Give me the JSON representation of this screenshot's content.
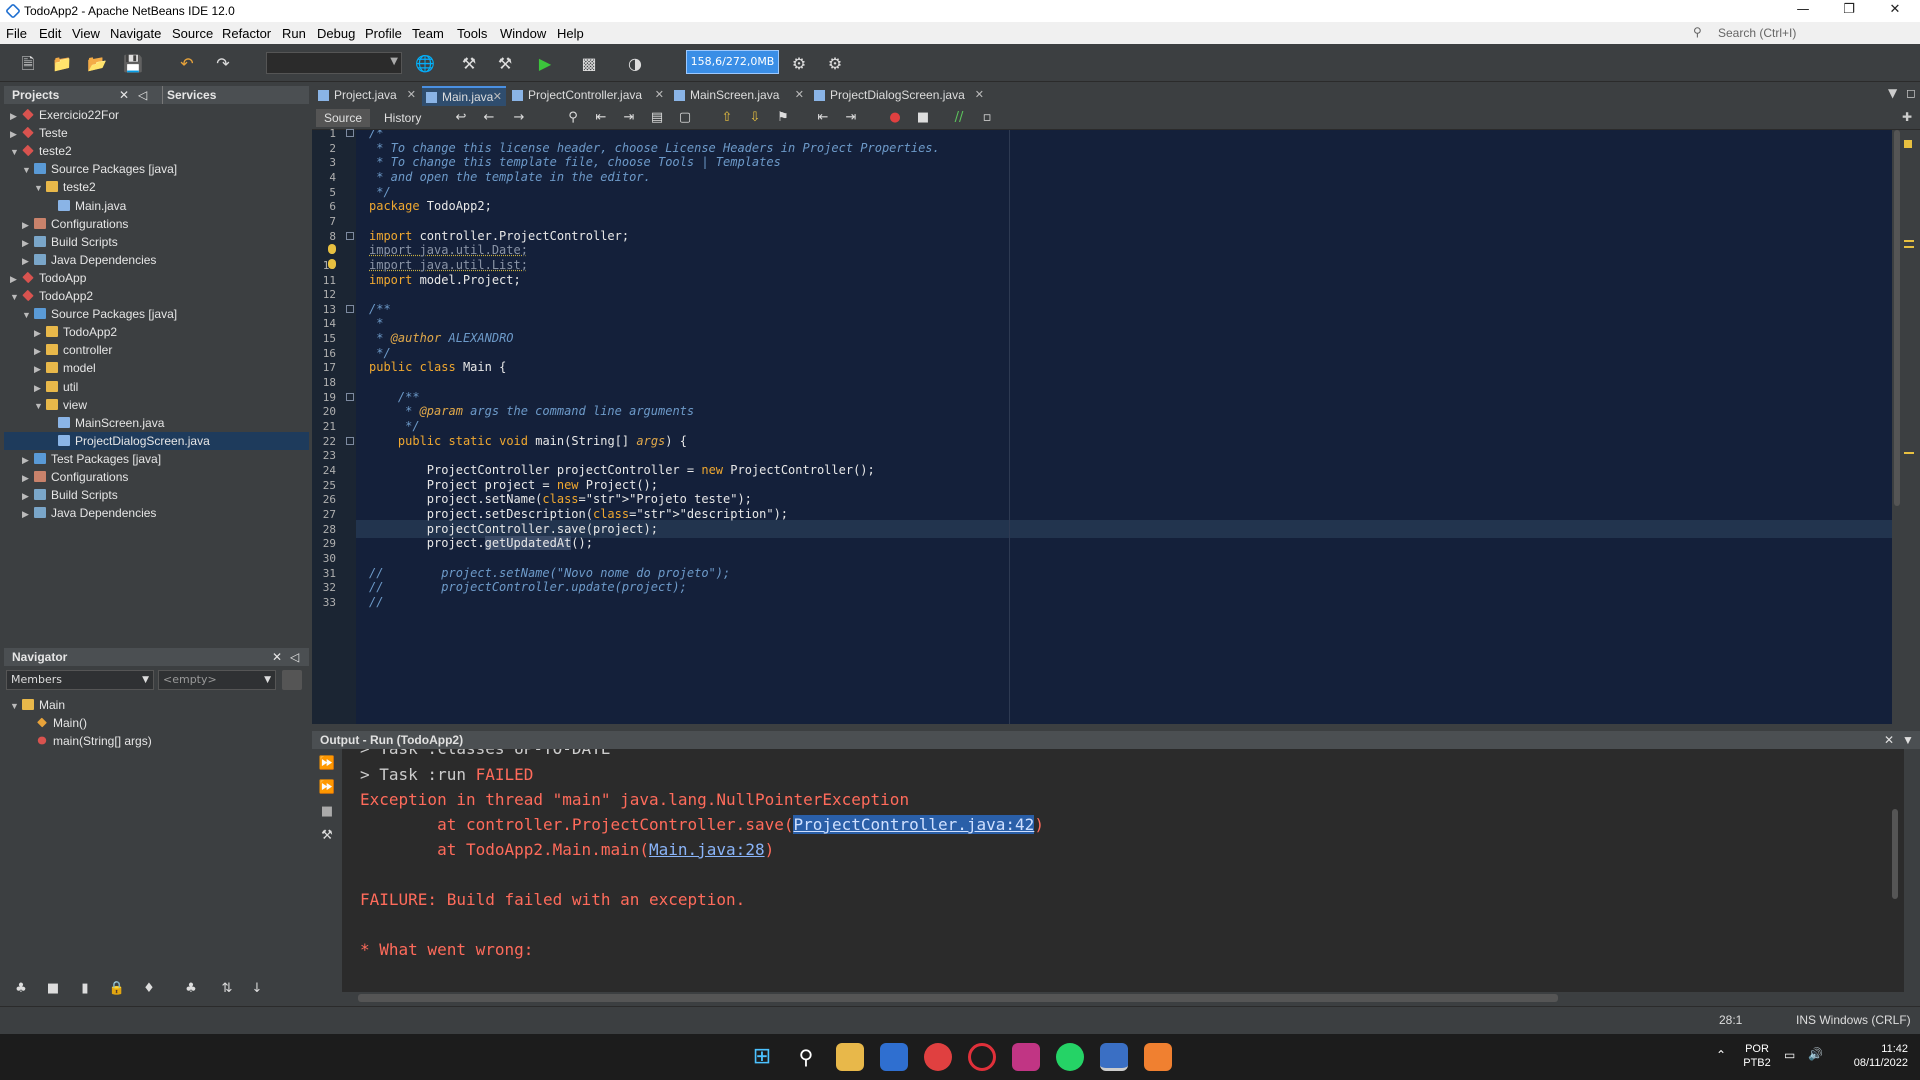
{
  "window": {
    "title": "TodoApp2 - Apache NetBeans IDE 12.0"
  },
  "menu": [
    "File",
    "Edit",
    "View",
    "Navigate",
    "Source",
    "Refactor",
    "Run",
    "Debug",
    "Profile",
    "Team",
    "Tools",
    "Window",
    "Help"
  ],
  "search": {
    "placeholder": "Search (Ctrl+I)"
  },
  "toolbar": {
    "memory": "158,6/272,0MB"
  },
  "projects_panel": {
    "title": "Projects",
    "services_title": "Services"
  },
  "tree": [
    {
      "label": "Exercicio22For",
      "depth": 0,
      "expanded": false,
      "icon": "proj"
    },
    {
      "label": "Teste",
      "depth": 0,
      "expanded": false,
      "icon": "proj"
    },
    {
      "label": "teste2",
      "depth": 0,
      "expanded": true,
      "icon": "proj"
    },
    {
      "label": "Source Packages [java]",
      "depth": 1,
      "expanded": true,
      "icon": "src"
    },
    {
      "label": "teste2",
      "depth": 2,
      "expanded": true,
      "icon": "pkg"
    },
    {
      "label": "Main.java",
      "depth": 3,
      "icon": "file"
    },
    {
      "label": "Configurations",
      "depth": 1,
      "expanded": false,
      "icon": "cfg"
    },
    {
      "label": "Build Scripts",
      "depth": 1,
      "expanded": false,
      "icon": "lib"
    },
    {
      "label": "Java Dependencies",
      "depth": 1,
      "expanded": false,
      "icon": "lib"
    },
    {
      "label": "TodoApp",
      "depth": 0,
      "expanded": false,
      "icon": "proj"
    },
    {
      "label": "TodoApp2",
      "depth": 0,
      "expanded": true,
      "icon": "proj"
    },
    {
      "label": "Source Packages [java]",
      "depth": 1,
      "expanded": true,
      "icon": "src"
    },
    {
      "label": "TodoApp2",
      "depth": 2,
      "expanded": false,
      "icon": "pkg"
    },
    {
      "label": "controller",
      "depth": 2,
      "expanded": false,
      "icon": "pkg"
    },
    {
      "label": "model",
      "depth": 2,
      "expanded": false,
      "icon": "pkg"
    },
    {
      "label": "util",
      "depth": 2,
      "expanded": false,
      "icon": "pkg"
    },
    {
      "label": "view",
      "depth": 2,
      "expanded": true,
      "icon": "pkg"
    },
    {
      "label": "MainScreen.java",
      "depth": 3,
      "icon": "file"
    },
    {
      "label": "ProjectDialogScreen.java",
      "depth": 3,
      "icon": "file",
      "selected": true
    },
    {
      "label": "Test Packages [java]",
      "depth": 1,
      "expanded": false,
      "icon": "src"
    },
    {
      "label": "Configurations",
      "depth": 1,
      "expanded": false,
      "icon": "cfg"
    },
    {
      "label": "Build Scripts",
      "depth": 1,
      "expanded": false,
      "icon": "lib"
    },
    {
      "label": "Java Dependencies",
      "depth": 1,
      "expanded": false,
      "icon": "lib"
    }
  ],
  "navigator": {
    "title": "Navigator",
    "filter": "Members",
    "empty": "<empty>",
    "items": [
      {
        "label": "Main",
        "depth": 0
      },
      {
        "label": "Main()",
        "depth": 1
      },
      {
        "label": "main(String[] args)",
        "depth": 1
      }
    ]
  },
  "tabs": [
    {
      "label": "Project.java",
      "active": false
    },
    {
      "label": "Main.java",
      "active": true
    },
    {
      "label": "ProjectController.java",
      "active": false
    },
    {
      "label": "MainScreen.java",
      "active": false
    },
    {
      "label": "ProjectDialogScreen.java",
      "active": false
    }
  ],
  "editor": {
    "source_tab": "Source",
    "history_tab": "History"
  },
  "code_lines": [
    "/*",
    " * To change this license header, choose License Headers in Project Properties.",
    " * To change this template file, choose Tools | Templates",
    " * and open the template in the editor.",
    " */",
    "package TodoApp2;",
    "",
    "import controller.ProjectController;",
    "import java.util.Date;",
    "import java.util.List;",
    "import model.Project;",
    "",
    "/**",
    " *",
    " * @author ALEXANDRO",
    " */",
    "public class Main {",
    "",
    "    /**",
    "     * @param args the command line arguments",
    "     */",
    "    public static void main(String[] args) {",
    "",
    "        ProjectController projectController = new ProjectController();",
    "        Project project = new Project();",
    "        project.setName(\"Projeto teste\");",
    "        project.setDescription(\"description\");",
    "        projectController.save(project);",
    "        project.getUpdatedAt();",
    "",
    "//        project.setName(\"Novo nome do projeto\");",
    "//        projectController.update(project);",
    "//"
  ],
  "output": {
    "title": "Output - Run (TodoApp2)",
    "lines": [
      "> Task :run FAILED",
      "Exception in thread \"main\" java.lang.NullPointerException",
      "        at controller.ProjectController.save(",
      "ProjectController.java:42",
      ")",
      "        at TodoApp2.Main.main(",
      "Main.java:28",
      ")",
      "FAILURE: Build failed with an exception.",
      "* What went wrong:"
    ],
    "partial_top": "> Task :classes UP-TO-DATE"
  },
  "status": {
    "position": "28:1",
    "mode": "INS Windows (CRLF)"
  },
  "taskbar": {
    "lang": "POR",
    "layout": "PTB2",
    "time": "11:42",
    "date": "08/11/2022"
  }
}
